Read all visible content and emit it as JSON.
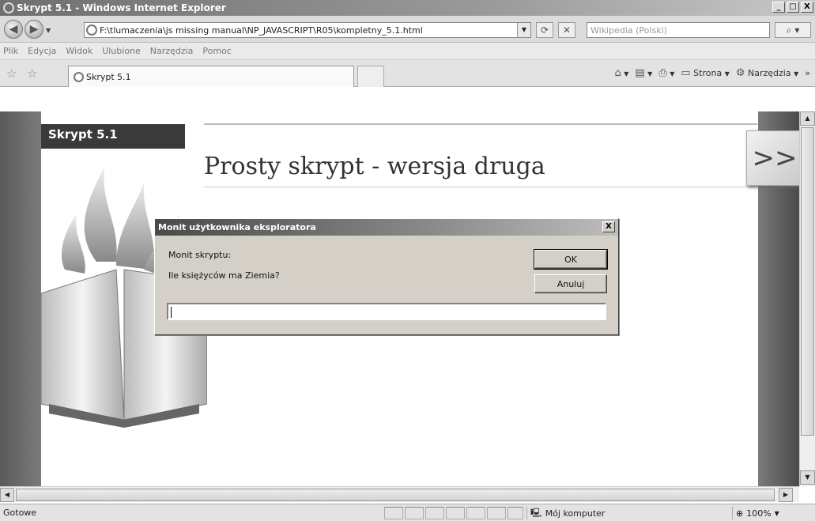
{
  "window": {
    "title": "Skrypt 5.1 - Windows Internet Explorer",
    "minimize": "_",
    "maximize": "□",
    "close": "X"
  },
  "address_bar": {
    "url": "F:\\tlumaczenia\\js missing manual\\NP_JAVASCRIPT\\R05\\kompletny_5.1.html",
    "refresh_glyph": "⟳",
    "stop_glyph": "✕",
    "search_placeholder": "Wikipedia (Polski)",
    "search_glyph": "⌕"
  },
  "menu": {
    "items": [
      "Plik",
      "Edycja",
      "Widok",
      "Ulubione",
      "Narzędzia",
      "Pomoc"
    ]
  },
  "tabs": {
    "active_label": "Skrypt 5.1"
  },
  "command_bar": {
    "home_glyph": "⌂",
    "feeds_glyph": "▤",
    "print_glyph": "⎙",
    "page_label": "Strona",
    "tools_label": "Narzędzia",
    "more_glyph": "»"
  },
  "page": {
    "script_label": "Skrypt 5.1",
    "heading": "Prosty skrypt - wersja druga",
    "next_glyph": ">>"
  },
  "dialog": {
    "title": "Monit użytkownika eksploratora",
    "close": "X",
    "prompt_caption": "Monit skryptu:",
    "question": "Ile księżyców ma Ziemia?",
    "ok_label": "OK",
    "cancel_label": "Anuluj",
    "input_value": ""
  },
  "status_bar": {
    "status": "Gotowe",
    "zone": "Mój komputer",
    "zoom": "100%"
  },
  "colors": {
    "title_bar": "#7a7a7a",
    "dialog_face": "#d4d0c8",
    "page_band": "#5a5a5a"
  }
}
